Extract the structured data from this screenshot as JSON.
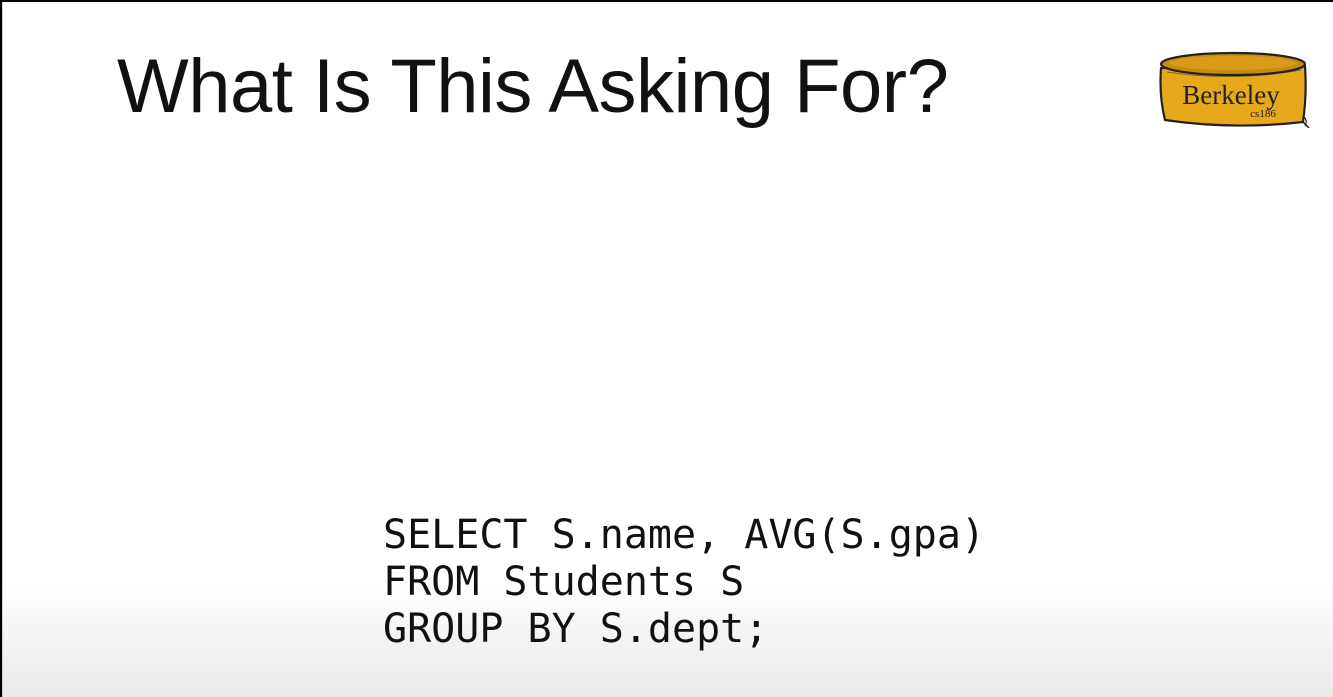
{
  "slide": {
    "title": "What Is This Asking For?",
    "logo": {
      "name": "Berkeley",
      "course": "cs186",
      "colors": {
        "gold": "#e8a81b",
        "gold_dark": "#c98a10",
        "outline": "#222222"
      }
    },
    "code_lines": [
      "SELECT S.name, AVG(S.gpa)",
      "FROM Students S",
      "GROUP BY S.dept;"
    ]
  }
}
